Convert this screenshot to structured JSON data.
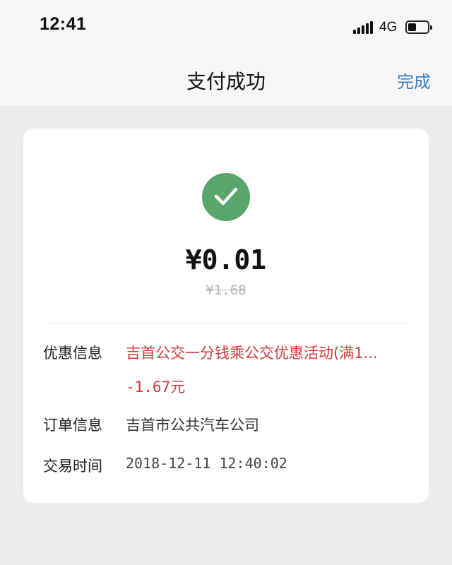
{
  "status_bar": {
    "time": "12:41",
    "network": "4G"
  },
  "nav": {
    "title": "支付成功",
    "done_label": "完成"
  },
  "payment": {
    "amount": "¥0.01",
    "original_amount": "¥1.68",
    "details": {
      "discount_label": "优惠信息",
      "discount_desc": "吉首公交一分钱乘公交优惠活动(满1...",
      "discount_amount": "-1.67元",
      "order_label": "订单信息",
      "order_value": "吉首市公共汽车公司",
      "time_label": "交易时间",
      "time_value": "2018-12-11 12:40:02"
    }
  },
  "colors": {
    "success": "#5aa66a",
    "accent": "#3a7fc9",
    "discount": "#d53a3a"
  },
  "icons": {
    "status": "check-circle-icon"
  }
}
